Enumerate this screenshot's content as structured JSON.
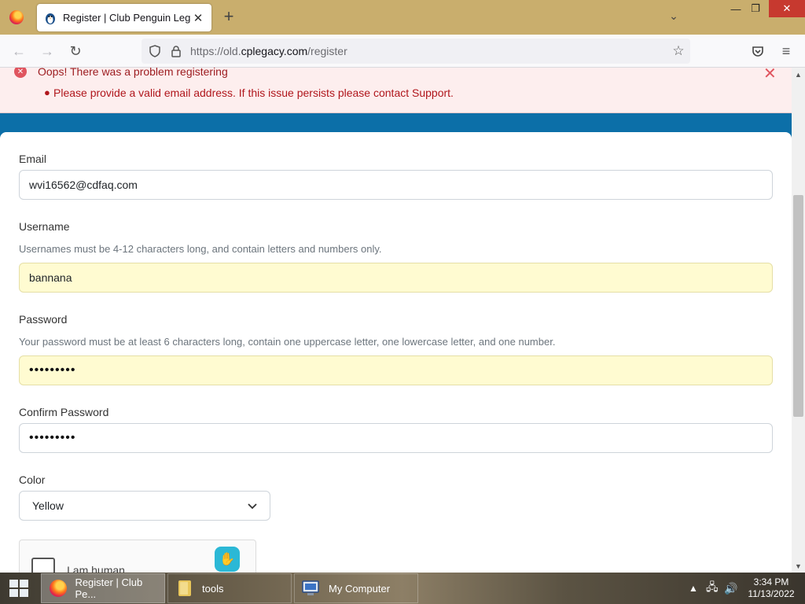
{
  "browser": {
    "tab_title": "Register | Club Penguin Legacy",
    "url_host": "https://old.",
    "url_domain": "cplegacy.com",
    "url_path": "/register"
  },
  "alert": {
    "title": "Oops! There was a problem registering",
    "message": "Please provide a valid email address. If this issue persists please contact Support."
  },
  "form": {
    "email": {
      "label": "Email",
      "value": "wvi16562@cdfaq.com"
    },
    "username": {
      "label": "Username",
      "hint": "Usernames must be 4-12 characters long, and contain letters and numbers only.",
      "value": "bannana"
    },
    "password": {
      "label": "Password",
      "hint": "Your password must be at least 6 characters long, contain one uppercase letter, one lowercase letter, and one number.",
      "value": "•••••••••"
    },
    "confirm_password": {
      "label": "Confirm Password",
      "value": "•••••••••"
    },
    "color": {
      "label": "Color",
      "value": "Yellow"
    },
    "captcha": {
      "label": "I am human"
    }
  },
  "taskbar": {
    "items": [
      {
        "label": "Register | Club Pe...",
        "icon": "firefox-icon"
      },
      {
        "label": "tools",
        "icon": "folder-icon"
      },
      {
        "label": "My Computer",
        "icon": "computer-icon"
      }
    ],
    "time": "3:34 PM",
    "date": "11/13/2022"
  },
  "colors": {
    "accent_blue": "#0c6fa8",
    "error_red": "#b0161c",
    "autofill_yellow": "#fffbd1"
  }
}
